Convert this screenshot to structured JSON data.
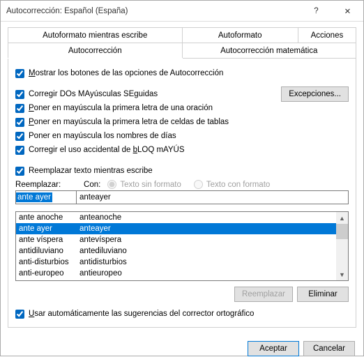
{
  "title": "Autocorrección: Español (España)",
  "titlebar": {
    "help_icon": "?",
    "close_icon": "✕"
  },
  "tabs": {
    "row1": [
      "Autoformato mientras escribe",
      "Autoformato",
      "Acciones"
    ],
    "row2": [
      "Autocorrección",
      "Autocorrección matemática"
    ],
    "active": "Autocorrección"
  },
  "checkboxes": {
    "show_buttons": "Mostrar los botones de las opciones de Autocorrección",
    "two_caps": "Corregir DOs MAyúsculas SEguidas",
    "first_sentence": "Poner en mayúscula la primera letra de una oración",
    "first_cell": "Poner en mayúscula la primera letra de celdas de tablas",
    "day_names": "Poner en mayúscula los nombres de días",
    "caps_lock": "Corregir el uso accidental de bLOQ mAYÚS",
    "replace_while": "Reemplazar texto mientras escribe",
    "use_spellcheck": "Usar automáticamente las sugerencias del corrector ortográfico"
  },
  "buttons": {
    "exceptions": "Excepciones...",
    "replace": "Reemplazar",
    "delete": "Eliminar",
    "ok": "Aceptar",
    "cancel": "Cancelar"
  },
  "field_labels": {
    "replace": "Reemplazar:",
    "with": "Con:",
    "radio_plain": "Texto sin formato",
    "radio_formatted": "Texto con formato"
  },
  "field_values": {
    "replace": "ante ayer",
    "with": "anteayer"
  },
  "list": [
    {
      "from": "ante anoche",
      "to": "anteanoche",
      "sel": false
    },
    {
      "from": "ante ayer",
      "to": "anteayer",
      "sel": true
    },
    {
      "from": "ante víspera",
      "to": "antevíspera",
      "sel": false
    },
    {
      "from": "antidiluviano",
      "to": "antediluviano",
      "sel": false
    },
    {
      "from": "anti-disturbios",
      "to": "antidisturbios",
      "sel": false
    },
    {
      "from": "anti-europeo",
      "to": "antieuropeo",
      "sel": false
    }
  ]
}
